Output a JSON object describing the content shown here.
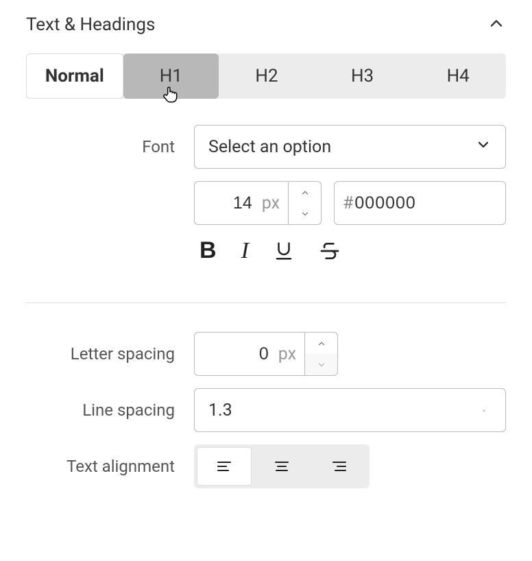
{
  "section": {
    "title": "Text & Headings"
  },
  "tabs": [
    "Normal",
    "H1",
    "H2",
    "H3",
    "H4"
  ],
  "font": {
    "label": "Font",
    "placeholder": "Select an option",
    "size_value": "14",
    "size_unit": "px",
    "color_hex": "000000",
    "swatch": "#000000"
  },
  "letter_spacing": {
    "label": "Letter spacing",
    "value": "0",
    "unit": "px"
  },
  "line_spacing": {
    "label": "Line spacing",
    "value": "1.3"
  },
  "text_alignment": {
    "label": "Text alignment"
  }
}
